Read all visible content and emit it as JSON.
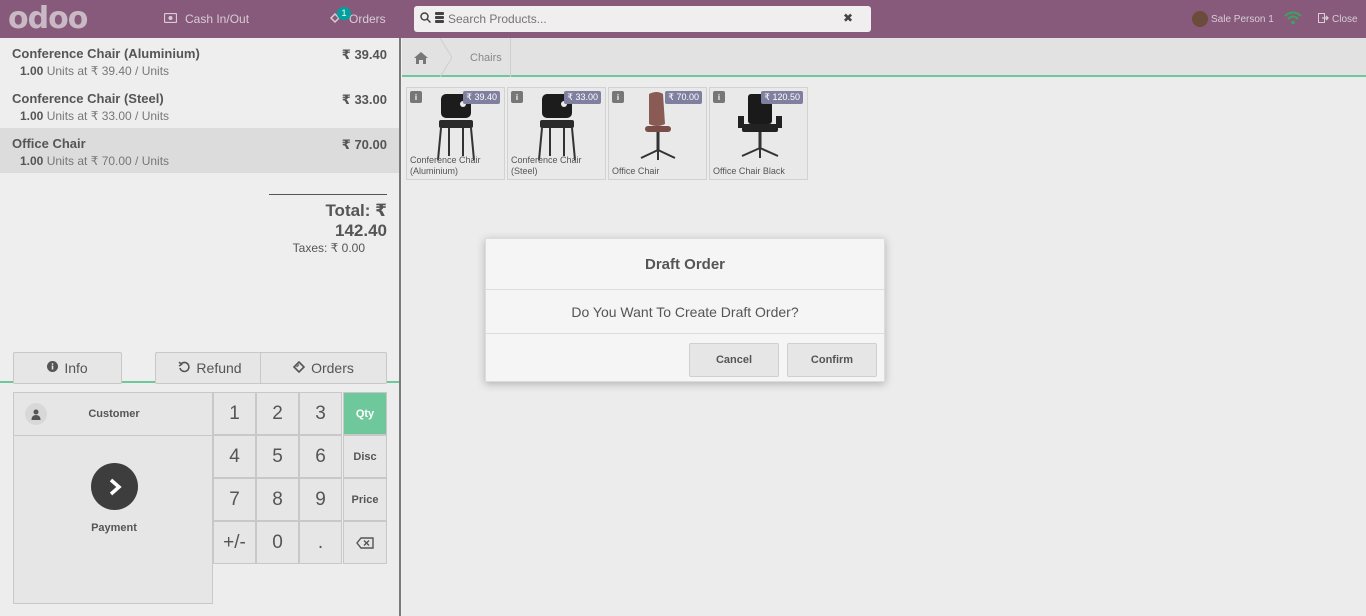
{
  "topbar": {
    "logo": "odoo",
    "cash_label": "Cash In/Out",
    "orders_label": "Orders",
    "orders_badge": "1",
    "search_placeholder": "Search Products...",
    "user_name": "Sale Person 1",
    "close_label": "Close"
  },
  "order": {
    "lines": [
      {
        "name": "Conference Chair (Aluminium)",
        "price": "₹ 39.40",
        "qty": "1.00",
        "unit_info": "Units at ₹ 39.40 / Units"
      },
      {
        "name": "Conference Chair (Steel)",
        "price": "₹ 33.00",
        "qty": "1.00",
        "unit_info": "Units at ₹ 33.00 / Units"
      },
      {
        "name": "Office Chair",
        "price": "₹ 70.00",
        "qty": "1.00",
        "unit_info": "Units at ₹ 70.00 / Units"
      }
    ],
    "total": "Total: ₹ 142.40",
    "taxes": "Taxes: ₹ 0.00"
  },
  "controls": {
    "info": "Info",
    "refund": "Refund",
    "orders": "Orders"
  },
  "pad": {
    "customer": "Customer",
    "payment": "Payment",
    "keys": [
      "1",
      "2",
      "3",
      "4",
      "5",
      "6",
      "7",
      "8",
      "9",
      "+/-",
      "0",
      "."
    ],
    "modes": [
      "Qty",
      "Disc",
      "Price"
    ],
    "active_mode": "Qty"
  },
  "breadcrumb": {
    "category": "Chairs"
  },
  "products": [
    {
      "name": "Conference Chair (Aluminium)",
      "price": "₹ 39.40"
    },
    {
      "name": "Conference Chair (Steel)",
      "price": "₹ 33.00"
    },
    {
      "name": "Office Chair",
      "price": "₹ 70.00"
    },
    {
      "name": "Office Chair Black",
      "price": "₹ 120.50"
    }
  ],
  "modal": {
    "title": "Draft Order",
    "body": "Do You Want To Create Draft Order?",
    "cancel": "Cancel",
    "confirm": "Confirm"
  },
  "colors": {
    "brand": "#875a7b",
    "accent": "#6ec89b"
  }
}
